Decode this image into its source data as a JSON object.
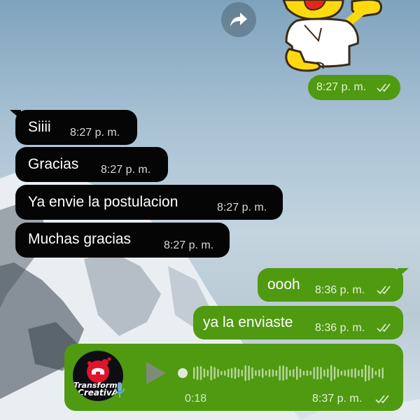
{
  "messages": [
    {
      "id": "siii",
      "direction": "incoming",
      "text": "Siiii",
      "time": "8:27 p. m."
    },
    {
      "id": "gracias",
      "direction": "incoming",
      "text": "Gracias",
      "time": "8:27 p. m."
    },
    {
      "id": "postulacion",
      "direction": "incoming",
      "text": "Ya envie la postulacion",
      "time": "8:27 p. m."
    },
    {
      "id": "muchas-gracias",
      "direction": "incoming",
      "text": "Muchas gracias",
      "time": "8:27 p. m."
    },
    {
      "id": "oooh",
      "direction": "outgoing",
      "text": "oooh",
      "time": "8:36 p. m.",
      "status": "read"
    },
    {
      "id": "enviaste",
      "direction": "outgoing",
      "text": "ya la enviaste",
      "time": "8:36 p. m.",
      "status": "read"
    }
  ],
  "sticker_message": {
    "time": "8:27 p. m.",
    "status": "read",
    "sticker_icon": "homer-thumbs-up-sticker"
  },
  "voice_message": {
    "duration": "0:18",
    "time": "8:37 p. m.",
    "status": "read",
    "playback_progress": 0,
    "avatar_text_line1": "Transforma",
    "avatar_text_line2": "CreativA",
    "play_icon": "play-icon",
    "mic_icon": "microphone-icon"
  },
  "forward_icon": "forward-share-icon",
  "colors": {
    "incoming_bubble": "#050505",
    "outgoing_bubble": "#4f9a10",
    "read_check": "#d8ecc4"
  }
}
